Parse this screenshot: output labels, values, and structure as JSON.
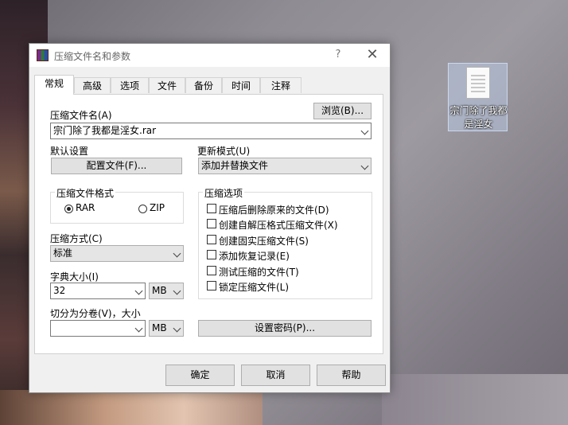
{
  "desktop": {
    "icon_label": "宗门除了我都是淫女"
  },
  "window": {
    "title": "压缩文件名和参数",
    "help_glyph": "?",
    "close_glyph": "✕"
  },
  "tabs": [
    "常规",
    "高级",
    "选项",
    "文件",
    "备份",
    "时间",
    "注释"
  ],
  "general": {
    "archive_name_label": "压缩文件名(A)",
    "browse_button": "浏览(B)...",
    "archive_name_value": "宗门除了我都是淫女.rar",
    "default_settings_label": "默认设置",
    "profiles_button": "配置文件(F)...",
    "update_mode_label": "更新模式(U)",
    "update_mode_value": "添加并替换文件",
    "format_group_title": "压缩文件格式",
    "format_rar": "RAR",
    "format_zip": "ZIP",
    "format_selected": "RAR",
    "method_label": "压缩方式(C)",
    "method_value": "标准",
    "dict_label": "字典大小(I)",
    "dict_value": "32",
    "dict_unit": "MB",
    "split_label": "切分为分卷(V)，大小",
    "split_value": "",
    "split_unit": "MB",
    "options_group_title": "压缩选项",
    "options": [
      {
        "label": "压缩后删除原来的文件(D)",
        "checked": false
      },
      {
        "label": "创建自解压格式压缩文件(X)",
        "checked": false
      },
      {
        "label": "创建固实压缩文件(S)",
        "checked": false
      },
      {
        "label": "添加恢复记录(E)",
        "checked": false
      },
      {
        "label": "测试压缩的文件(T)",
        "checked": false
      },
      {
        "label": "锁定压缩文件(L)",
        "checked": false
      }
    ],
    "password_button": "设置密码(P)..."
  },
  "footer": {
    "ok": "确定",
    "cancel": "取消",
    "help": "帮助"
  },
  "colors": {
    "window_bg": "#f0f0f0",
    "panel_bg": "#ffffff",
    "button_bg": "#e1e1e1"
  }
}
